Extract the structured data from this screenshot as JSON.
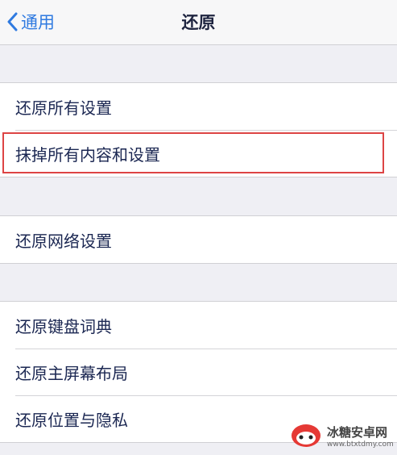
{
  "nav": {
    "back_label": "通用",
    "title": "还原"
  },
  "groups": [
    {
      "items": [
        {
          "label": "还原所有设置"
        },
        {
          "label": "抹掉所有内容和设置"
        }
      ]
    },
    {
      "items": [
        {
          "label": "还原网络设置"
        }
      ]
    },
    {
      "items": [
        {
          "label": "还原键盘词典"
        },
        {
          "label": "还原主屏幕布局"
        },
        {
          "label": "还原位置与隐私"
        }
      ]
    }
  ],
  "watermark": {
    "brand": "冰糖安卓网",
    "url": "www.btxtdmy.com"
  },
  "colors": {
    "accent": "#2f7ae0",
    "highlight_box": "#dd4444",
    "background": "#efeff4"
  },
  "icons": {
    "back": "chevron-left-icon",
    "watermark_logo": "brand-logo-icon"
  }
}
